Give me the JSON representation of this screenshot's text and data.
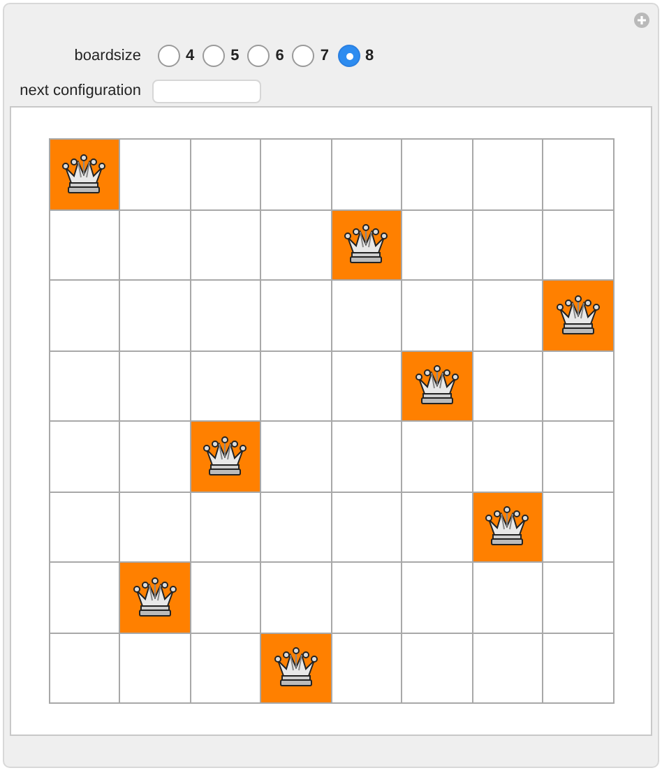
{
  "boardsize": {
    "label": "boardsize",
    "options": [
      {
        "label": "4",
        "selected": false
      },
      {
        "label": "5",
        "selected": false
      },
      {
        "label": "6",
        "selected": false
      },
      {
        "label": "7",
        "selected": false
      },
      {
        "label": "8",
        "selected": true
      }
    ]
  },
  "next_configuration": {
    "label": "next configuration"
  },
  "board": {
    "rows": [
      [
        true,
        false,
        false,
        false,
        false,
        false,
        false,
        false
      ],
      [
        false,
        false,
        false,
        false,
        true,
        false,
        false,
        false
      ],
      [
        false,
        false,
        false,
        false,
        false,
        false,
        false,
        true
      ],
      [
        false,
        false,
        false,
        false,
        false,
        true,
        false,
        false
      ],
      [
        false,
        false,
        true,
        false,
        false,
        false,
        false,
        false
      ],
      [
        false,
        false,
        false,
        false,
        false,
        false,
        true,
        false
      ],
      [
        false,
        true,
        false,
        false,
        false,
        false,
        false,
        false
      ],
      [
        false,
        false,
        false,
        true,
        false,
        false,
        false,
        false
      ]
    ]
  }
}
